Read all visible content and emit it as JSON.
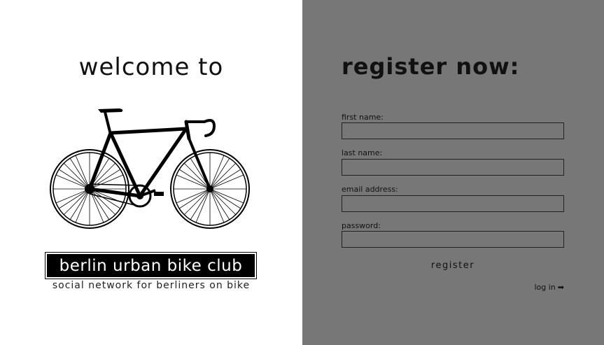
{
  "welcome": {
    "title": "welcome to",
    "brand": "berlin urban bike club",
    "tagline": "social network for berliners on bike",
    "image": "bicycle-illustration"
  },
  "register": {
    "title": "register now:",
    "fields": [
      {
        "label": "first name:",
        "value": ""
      },
      {
        "label": "last name:",
        "value": ""
      },
      {
        "label": "email address:",
        "value": ""
      },
      {
        "label": "password:",
        "value": ""
      }
    ],
    "submit_label": "register",
    "login_label": "log in",
    "login_icon": "right-arrow-icon"
  },
  "colors": {
    "left_background": "#ffffff",
    "right_background": "#777777",
    "brand_background": "#000000",
    "text": "#111111"
  }
}
